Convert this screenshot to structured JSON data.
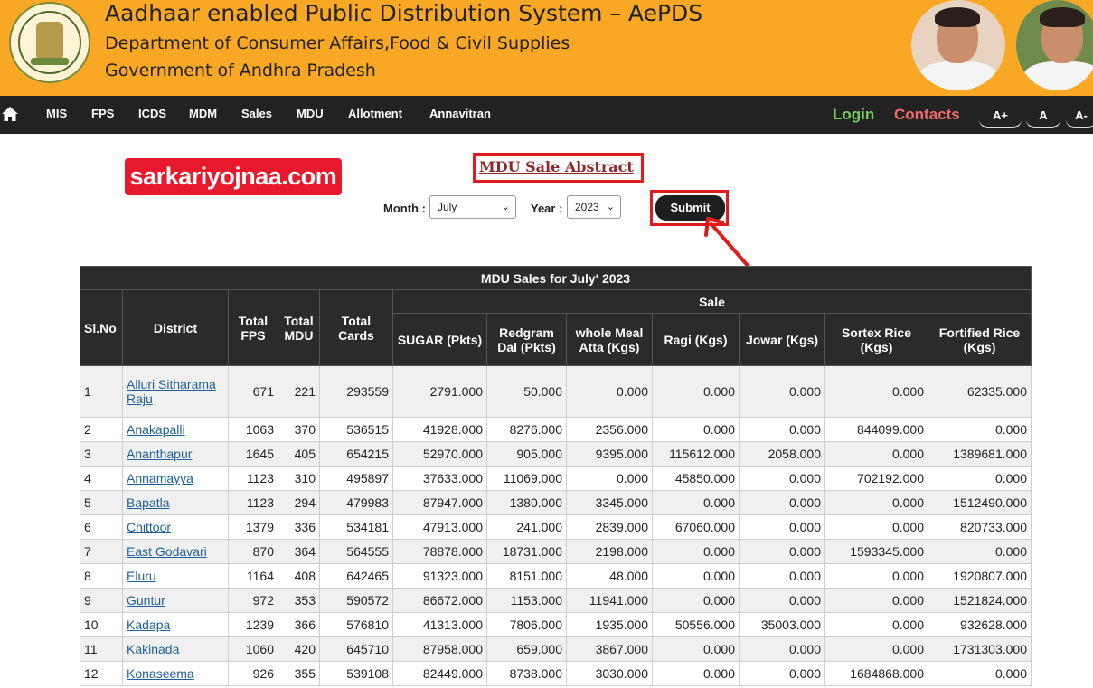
{
  "header": {
    "title": "Aadhaar enabled Public Distribution System – AePDS",
    "subtitle1": "Department of Consumer Affairs,Food & Civil Supplies",
    "subtitle2": "Government of Andhra Pradesh"
  },
  "nav": {
    "items": [
      "MIS",
      "FPS",
      "ICDS",
      "MDM",
      "Sales",
      "MDU",
      "Allotment",
      "Annavitran"
    ],
    "login": "Login",
    "contacts": "Contacts",
    "font_buttons": [
      "A+",
      "A",
      "A-"
    ]
  },
  "watermark": "sarkariyojnaa.com",
  "page_title": "MDU Sale Abstract",
  "filters": {
    "month_label": "Month :",
    "month_value": "July",
    "year_label": "Year :",
    "year_value": "2023",
    "submit_label": "Submit"
  },
  "table": {
    "caption": "MDU Sales for July' 2023",
    "headers": {
      "slno": "Sl.No",
      "district": "District",
      "total_fps": "Total FPS",
      "total_mdu": "Total MDU",
      "total_cards": "Total Cards",
      "sale": "Sale",
      "sugar": "SUGAR (Pkts)",
      "redgram": "Redgram Dal (Pkts)",
      "atta": "whole Meal Atta (Kgs)",
      "ragi": "Ragi (Kgs)",
      "jowar": "Jowar (Kgs)",
      "sortex": "Sortex Rice (Kgs)",
      "fortified": "Fortified Rice (Kgs)"
    },
    "rows": [
      [
        "1",
        "Alluri Sitharama Raju",
        "671",
        "221",
        "293559",
        "2791.000",
        "50.000",
        "0.000",
        "0.000",
        "0.000",
        "0.000",
        "62335.000"
      ],
      [
        "2",
        "Anakapalli",
        "1063",
        "370",
        "536515",
        "41928.000",
        "8276.000",
        "2356.000",
        "0.000",
        "0.000",
        "844099.000",
        "0.000"
      ],
      [
        "3",
        "Ananthapur",
        "1645",
        "405",
        "654215",
        "52970.000",
        "905.000",
        "9395.000",
        "115612.000",
        "2058.000",
        "0.000",
        "1389681.000"
      ],
      [
        "4",
        "Annamayya",
        "1123",
        "310",
        "495897",
        "37633.000",
        "11069.000",
        "0.000",
        "45850.000",
        "0.000",
        "702192.000",
        "0.000"
      ],
      [
        "5",
        "Bapatla",
        "1123",
        "294",
        "479983",
        "87947.000",
        "1380.000",
        "3345.000",
        "0.000",
        "0.000",
        "0.000",
        "1512490.000"
      ],
      [
        "6",
        "Chittoor",
        "1379",
        "336",
        "534181",
        "47913.000",
        "241.000",
        "2839.000",
        "67060.000",
        "0.000",
        "0.000",
        "820733.000"
      ],
      [
        "7",
        "East Godavari",
        "870",
        "364",
        "564555",
        "78878.000",
        "18731.000",
        "2198.000",
        "0.000",
        "0.000",
        "1593345.000",
        "0.000"
      ],
      [
        "8",
        "Eluru",
        "1164",
        "408",
        "642465",
        "91323.000",
        "8151.000",
        "48.000",
        "0.000",
        "0.000",
        "0.000",
        "1920807.000"
      ],
      [
        "9",
        "Guntur",
        "972",
        "353",
        "590572",
        "86672.000",
        "1153.000",
        "11941.000",
        "0.000",
        "0.000",
        "0.000",
        "1521824.000"
      ],
      [
        "10",
        "Kadapa",
        "1239",
        "366",
        "576810",
        "41313.000",
        "7806.000",
        "1935.000",
        "50556.000",
        "35003.000",
        "0.000",
        "932628.000"
      ],
      [
        "11",
        "Kakinada",
        "1060",
        "420",
        "645710",
        "87958.000",
        "659.000",
        "3867.000",
        "0.000",
        "0.000",
        "0.000",
        "1731303.000"
      ],
      [
        "12",
        "Konaseema",
        "926",
        "355",
        "539108",
        "82449.000",
        "8738.000",
        "3030.000",
        "0.000",
        "0.000",
        "1684868.000",
        "0.000"
      ]
    ]
  },
  "colors": {
    "header_bg": "#f9a825",
    "nav_bg": "#222222",
    "login": "#6fcf5a",
    "contacts": "#ef6b6b",
    "highlight": "#e01b1b",
    "link": "#1d5f9a"
  }
}
